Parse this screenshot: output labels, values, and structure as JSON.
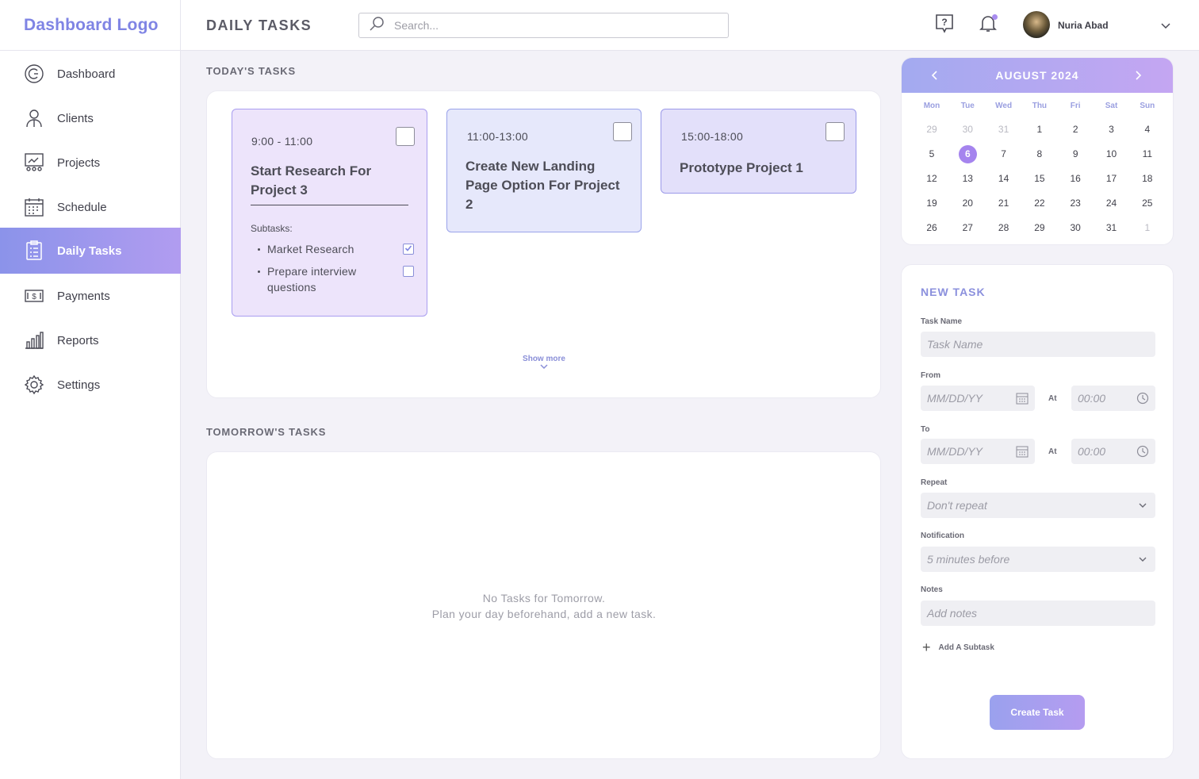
{
  "app": {
    "logo": "Dashboard Logo"
  },
  "header": {
    "title": "DAILY TASKS",
    "search_placeholder": "Search...",
    "user_name": "Nuria Abad"
  },
  "sidebar": {
    "items": [
      {
        "label": "Dashboard",
        "icon": "dashboard-icon"
      },
      {
        "label": "Clients",
        "icon": "clients-icon"
      },
      {
        "label": "Projects",
        "icon": "projects-icon"
      },
      {
        "label": "Schedule",
        "icon": "schedule-icon"
      },
      {
        "label": "Daily Tasks",
        "icon": "daily-tasks-icon",
        "active": true
      },
      {
        "label": "Payments",
        "icon": "payments-icon"
      },
      {
        "label": "Reports",
        "icon": "reports-icon"
      },
      {
        "label": "Settings",
        "icon": "settings-icon"
      }
    ]
  },
  "today": {
    "title": "TODAY'S TASKS",
    "tasks": [
      {
        "time": "9:00 - 11:00",
        "title": "Start Research For Project 3",
        "subtasks_label": "Subtasks:",
        "subtasks": [
          {
            "label": "Market Research",
            "checked": true
          },
          {
            "label": "Prepare interview questions",
            "checked": false
          }
        ]
      },
      {
        "time": "11:00-13:00",
        "title": "Create New Landing Page Option For Project 2"
      },
      {
        "time": "15:00-18:00",
        "title": "Prototype Project 1"
      }
    ],
    "show_more": "Show more"
  },
  "tomorrow": {
    "title": "TOMORROW'S TASKS",
    "empty_line1": "No Tasks for Tomorrow.",
    "empty_line2": "Plan your day beforehand, add a new task."
  },
  "calendar": {
    "month": "AUGUST 2024",
    "days_of_week": [
      "Mon",
      "Tue",
      "Wed",
      "Thu",
      "Fri",
      "Sat",
      "Sun"
    ],
    "weeks": [
      [
        "29",
        "30",
        "31",
        "1",
        "2",
        "3",
        "4"
      ],
      [
        "5",
        "6",
        "7",
        "8",
        "9",
        "10",
        "11"
      ],
      [
        "12",
        "13",
        "14",
        "15",
        "16",
        "17",
        "18"
      ],
      [
        "19",
        "20",
        "21",
        "22",
        "23",
        "24",
        "25"
      ],
      [
        "26",
        "27",
        "28",
        "29",
        "30",
        "31",
        "1"
      ]
    ],
    "today": "6",
    "accent": "#a584ee"
  },
  "new_task": {
    "title": "NEW TASK",
    "task_name_label": "Task Name",
    "task_name_placeholder": "Task Name",
    "from_label": "From",
    "to_label": "To",
    "date_placeholder": "MM/DD/YY",
    "at_label": "At",
    "time_placeholder": "00:00",
    "repeat_label": "Repeat",
    "repeat_value": "Don't repeat",
    "notification_label": "Notification",
    "notification_value": "5 minutes before",
    "notes_label": "Notes",
    "notes_placeholder": "Add notes",
    "add_subtask": "Add A Subtask",
    "create_button": "Create Task"
  }
}
